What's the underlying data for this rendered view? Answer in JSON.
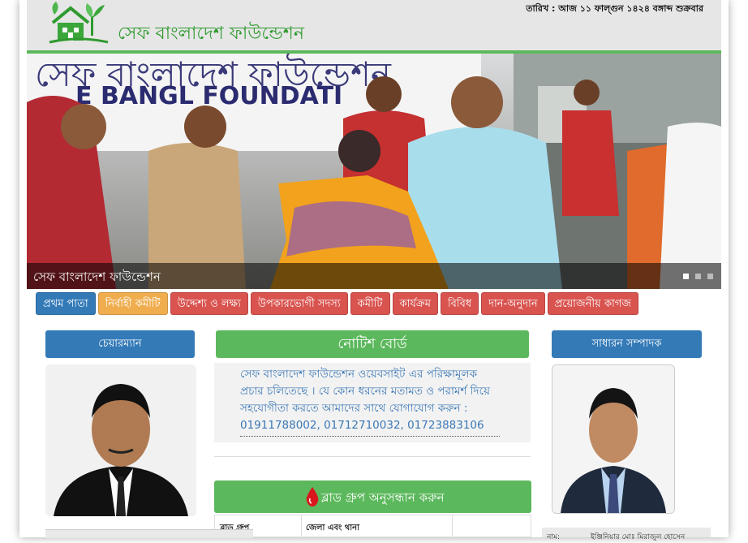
{
  "header": {
    "site_title": "সেফ বাংলাদেশ ফাউন্ডেশন",
    "date_text": "তারিখ : আজ ১১ ফাল্গুন ১৪২৪ বঙ্গাব্দ শুক্রবার"
  },
  "slider": {
    "caption": "সেফ বাংলাদেশ ফাউন্ডেশন",
    "banner_text": "সেফ বাংলাদেশ ফাউন্ডেশন",
    "banner_text_en": "E BANGL  FOUNDATI",
    "slide_count": 3,
    "active_index": 0
  },
  "nav": {
    "items": [
      {
        "label": "প্রথম পাতা",
        "color": "#337ab7"
      },
      {
        "label": "নির্বাহী কমীটি",
        "color": "#f0ad4e"
      },
      {
        "label": "উদ্দেশ্য ও লক্ষ্য",
        "color": "#d9534f"
      },
      {
        "label": "উপকারভোগী সদস্য",
        "color": "#d9534f"
      },
      {
        "label": "কমীটি",
        "color": "#d9534f"
      },
      {
        "label": "কার্যক্রম",
        "color": "#d9534f"
      },
      {
        "label": "বিবিধ",
        "color": "#d9534f"
      },
      {
        "label": "দান-অনুদান",
        "color": "#d9534f"
      },
      {
        "label": "প্রয়োজনীয় কাগজ",
        "color": "#d9534f"
      }
    ]
  },
  "left_panel": {
    "title": "চেয়ারম্যান"
  },
  "right_panel": {
    "title": "সাধারন সম্পাদক",
    "footer_key": "নাম:",
    "footer_value": "ইঞ্জিনিয়ার মোঃ মিরাজুল হোসেন"
  },
  "notice": {
    "title": "নোটিশ বোর্ড",
    "text": "সেফ বাংলাদেশ ফাউন্ডেশন ওয়েবসাইট এর পরিক্ষামূলক প্রচার চলিতেছে । যে কোন ধরনের মতামত ও পরামর্শ দিয়ে সহযোগীতা করতে আমাদের সাথে যোগাযোগ করুন : 01911788002, 01712710032, 01723883106"
  },
  "blood": {
    "title": "ব্লাড গ্রুপ অনুসন্ধান করুন",
    "col1": "ব্লাড গ্রুপ",
    "col2": "জেলা এবং থানা"
  },
  "colors": {
    "green": "#5cb85c",
    "blue": "#337ab7",
    "orange": "#f0ad4e",
    "red": "#d9534f",
    "blood_drop": "#d9171a"
  }
}
